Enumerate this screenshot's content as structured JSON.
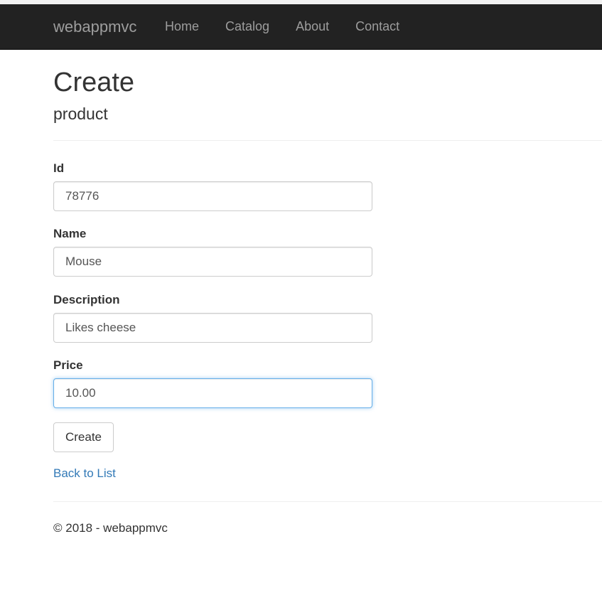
{
  "navbar": {
    "brand": "webappmvc",
    "items": [
      {
        "label": "Home"
      },
      {
        "label": "Catalog"
      },
      {
        "label": "About"
      },
      {
        "label": "Contact"
      }
    ]
  },
  "page": {
    "title": "Create",
    "subtitle": "product"
  },
  "form": {
    "fields": [
      {
        "label": "Id",
        "value": "78776"
      },
      {
        "label": "Name",
        "value": "Mouse"
      },
      {
        "label": "Description",
        "value": "Likes cheese"
      },
      {
        "label": "Price",
        "value": "10.00"
      }
    ],
    "submit_label": "Create"
  },
  "back_link": "Back to List",
  "footer": {
    "text": "© 2018 - webappmvc"
  },
  "colors": {
    "navbar_bg": "#222222",
    "nav_text": "#9d9d9d",
    "link": "#337ab7",
    "focus_border": "#66afe9"
  }
}
